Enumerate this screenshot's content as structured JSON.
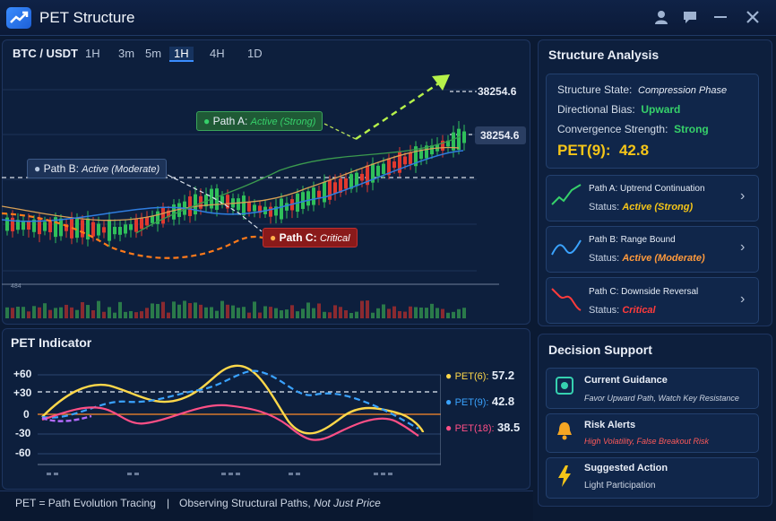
{
  "app": {
    "title": "PET Structure"
  },
  "toolbar": {
    "pair": "BTC / USDT",
    "timeframes": [
      "1H",
      "3m",
      "5m",
      "1H",
      "4H",
      "1D"
    ],
    "active_index": 3
  },
  "price": {
    "target": "38254.6",
    "current": "38254.6",
    "small_axis": "484"
  },
  "paths_on_chart": {
    "a": {
      "name": "Path A:",
      "status": "Active (Strong)"
    },
    "b": {
      "name": "Path B:",
      "status": "Active (Moderate)"
    },
    "c": {
      "name": "Path C:",
      "status": "Critical"
    }
  },
  "structure_analysis": {
    "title": "Structure Analysis",
    "state_label": "Structure State:",
    "state_value": "Compression Phase",
    "bias_label": "Directional Bias:",
    "bias_value": "Upward",
    "conv_label": "Convergence Strength:",
    "conv_value": "Strong",
    "pet_label": "PET(9):",
    "pet_value": "42.8",
    "cards": [
      {
        "title": "Path A: Uptrend Continuation",
        "status_label": "Status:",
        "status_value": "Active (Strong)",
        "color": "#f5c518"
      },
      {
        "title": "Path B: Range Bound",
        "status_label": "Status:",
        "status_value": "Active (Moderate)",
        "color": "#ff9a3c"
      },
      {
        "title": "Path C: Downside Reversal",
        "status_label": "Status:",
        "status_value": "Critical",
        "color": "#ff3b3b"
      }
    ]
  },
  "indicator": {
    "title": "PET Indicator",
    "y_ticks": [
      "+60",
      "+30",
      "0",
      "-30",
      "-60"
    ],
    "series": [
      {
        "name": "PET(6):",
        "value": "57.2",
        "color": "#ffd84a"
      },
      {
        "name": "PET(9):",
        "value": "42.8",
        "color": "#3aa3ff"
      },
      {
        "name": "PET(18):",
        "value": "38.5",
        "color": "#ff4f86"
      }
    ]
  },
  "decision_support": {
    "title": "Decision Support",
    "items": [
      {
        "title": "Current Guidance",
        "text": "Favor Upward Path, Watch Key Resistance",
        "color": "#cdd6e4"
      },
      {
        "title": "Risk Alerts",
        "text": "High Volatility, False Breakout Risk",
        "color": "#ff5a5a"
      },
      {
        "title": "Suggested Action",
        "text": "Light Participation",
        "color": "#cdd6e4"
      }
    ]
  },
  "footer": {
    "left": "PET = Path Evolution Tracing",
    "sep": "|",
    "right_a": "Observing Structural Paths,",
    "right_b": "Not Just Price"
  },
  "colors": {
    "accent": "#3a8dff",
    "green": "#36d16a",
    "red": "#ff3b3b",
    "orange": "#ff8a2a",
    "yellow": "#f5c518"
  }
}
